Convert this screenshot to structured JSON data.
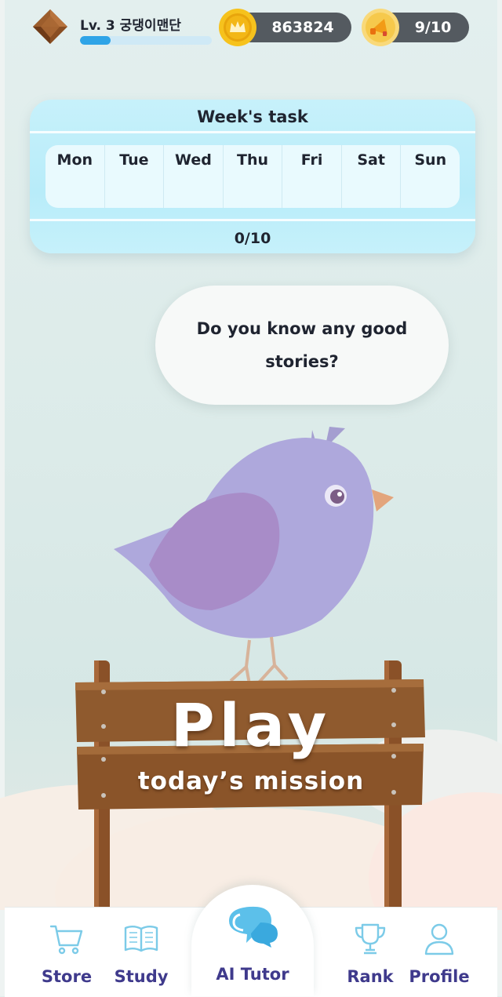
{
  "header": {
    "level_label": "Lv. 3 궁댕이맨단",
    "xp_progress": 0.23,
    "coins": "863824",
    "energy": "9/10"
  },
  "week_task": {
    "title": "Week's task",
    "days": [
      "Mon",
      "Tue",
      "Wed",
      "Thu",
      "Fri",
      "Sat",
      "Sun"
    ],
    "progress": "0/10"
  },
  "bubble": {
    "text": "Do you know any good stories?"
  },
  "sign": {
    "title": "Play",
    "subtitle": "today’s mission"
  },
  "nav": {
    "items": [
      {
        "label": "Store",
        "icon": "cart-icon"
      },
      {
        "label": "Study",
        "icon": "book-icon"
      },
      {
        "label": "AI Tutor",
        "icon": "chat-bubbles-icon"
      },
      {
        "label": "Rank",
        "icon": "trophy-icon"
      },
      {
        "label": "Profile",
        "icon": "user-icon"
      }
    ],
    "active": "AI Tutor"
  },
  "colors": {
    "accent": "#2fa4e7",
    "nav_label": "#3f3a8c",
    "nav_icon": "#7ccbe8",
    "card": "#b8ecf9",
    "wood": "#8a5128"
  }
}
